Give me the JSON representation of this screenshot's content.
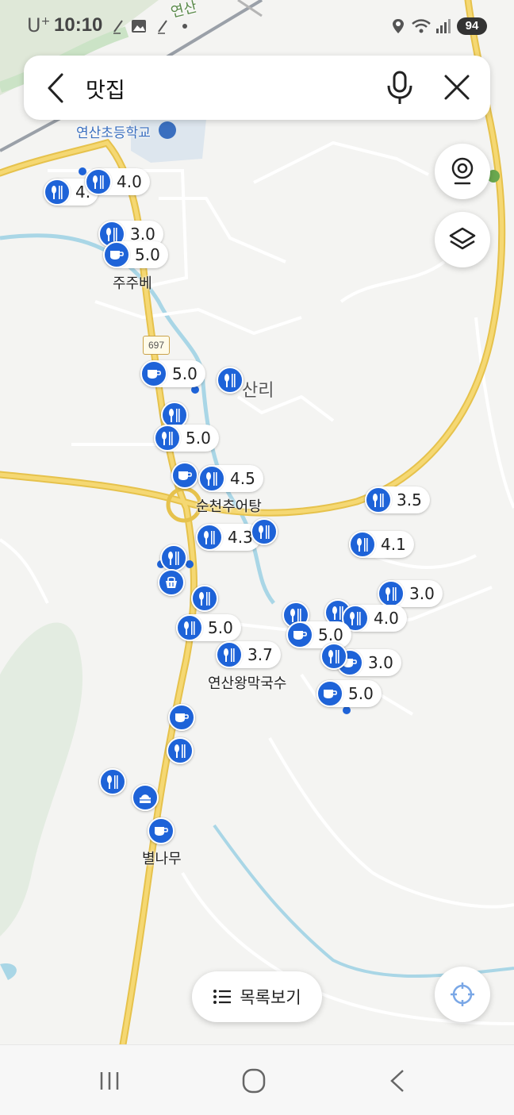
{
  "status_bar": {
    "carrier": "U",
    "carrier_sup": "+",
    "time": "10:10",
    "battery": "94"
  },
  "search": {
    "query": "맛집",
    "back_icon": "chevron-left-icon",
    "mic_icon": "microphone-icon",
    "clear_icon": "close-icon"
  },
  "map": {
    "labels": {
      "school": "연산초등학교",
      "area": "산리",
      "road_number": "697",
      "upper_road": "연산"
    },
    "places": {
      "jujube": "주주베",
      "suncheon": "순천추어탕",
      "yeonsan_noodle": "연산왕막국수",
      "star_tree": "별나무"
    },
    "markers": [
      {
        "icon": "restaurant-icon",
        "rating": "4."
      },
      {
        "icon": "restaurant-icon",
        "rating": "4.0"
      },
      {
        "icon": "restaurant-icon",
        "rating": "3.0"
      },
      {
        "icon": "cafe-icon",
        "rating": "5.0"
      },
      {
        "icon": "cafe-icon",
        "rating": "5.0"
      },
      {
        "icon": "restaurant-icon",
        "rating": ""
      },
      {
        "icon": "restaurant-icon",
        "rating": ""
      },
      {
        "icon": "restaurant-icon",
        "rating": "5.0"
      },
      {
        "icon": "cafe-icon",
        "rating": ""
      },
      {
        "icon": "restaurant-icon",
        "rating": "4.5"
      },
      {
        "icon": "restaurant-icon",
        "rating": "3.5"
      },
      {
        "icon": "restaurant-icon",
        "rating": "4.3"
      },
      {
        "icon": "restaurant-icon",
        "rating": ""
      },
      {
        "icon": "restaurant-icon",
        "rating": "4.1"
      },
      {
        "icon": "restaurant-icon",
        "rating": ""
      },
      {
        "icon": "bakery-icon",
        "rating": ""
      },
      {
        "icon": "restaurant-icon",
        "rating": ""
      },
      {
        "icon": "restaurant-icon",
        "rating": "3.0"
      },
      {
        "icon": "restaurant-icon",
        "rating": "5.0"
      },
      {
        "icon": "restaurant-icon",
        "rating": ""
      },
      {
        "icon": "restaurant-icon",
        "rating": ""
      },
      {
        "icon": "restaurant-icon",
        "rating": "4.0"
      },
      {
        "icon": "cafe-icon",
        "rating": "5.0"
      },
      {
        "icon": "restaurant-icon",
        "rating": "3.7"
      },
      {
        "icon": "cafe-icon",
        "rating": "3.0"
      },
      {
        "icon": "restaurant-icon",
        "rating": ""
      },
      {
        "icon": "cafe-icon",
        "rating": "5.0"
      },
      {
        "icon": "cafe-icon",
        "rating": ""
      },
      {
        "icon": "restaurant-icon",
        "rating": ""
      },
      {
        "icon": "restaurant-icon",
        "rating": ""
      },
      {
        "icon": "cake-icon",
        "rating": ""
      },
      {
        "icon": "cafe-icon",
        "rating": ""
      }
    ]
  },
  "controls": {
    "street_view_icon": "street-view-icon",
    "layers_icon": "layers-icon",
    "locate_icon": "crosshair-icon",
    "list_button_label": "목록보기",
    "list_icon": "list-icon"
  },
  "colors": {
    "marker_blue": "#1e63d8",
    "main_road": "#f5d060",
    "river": "#a9d6e6"
  }
}
